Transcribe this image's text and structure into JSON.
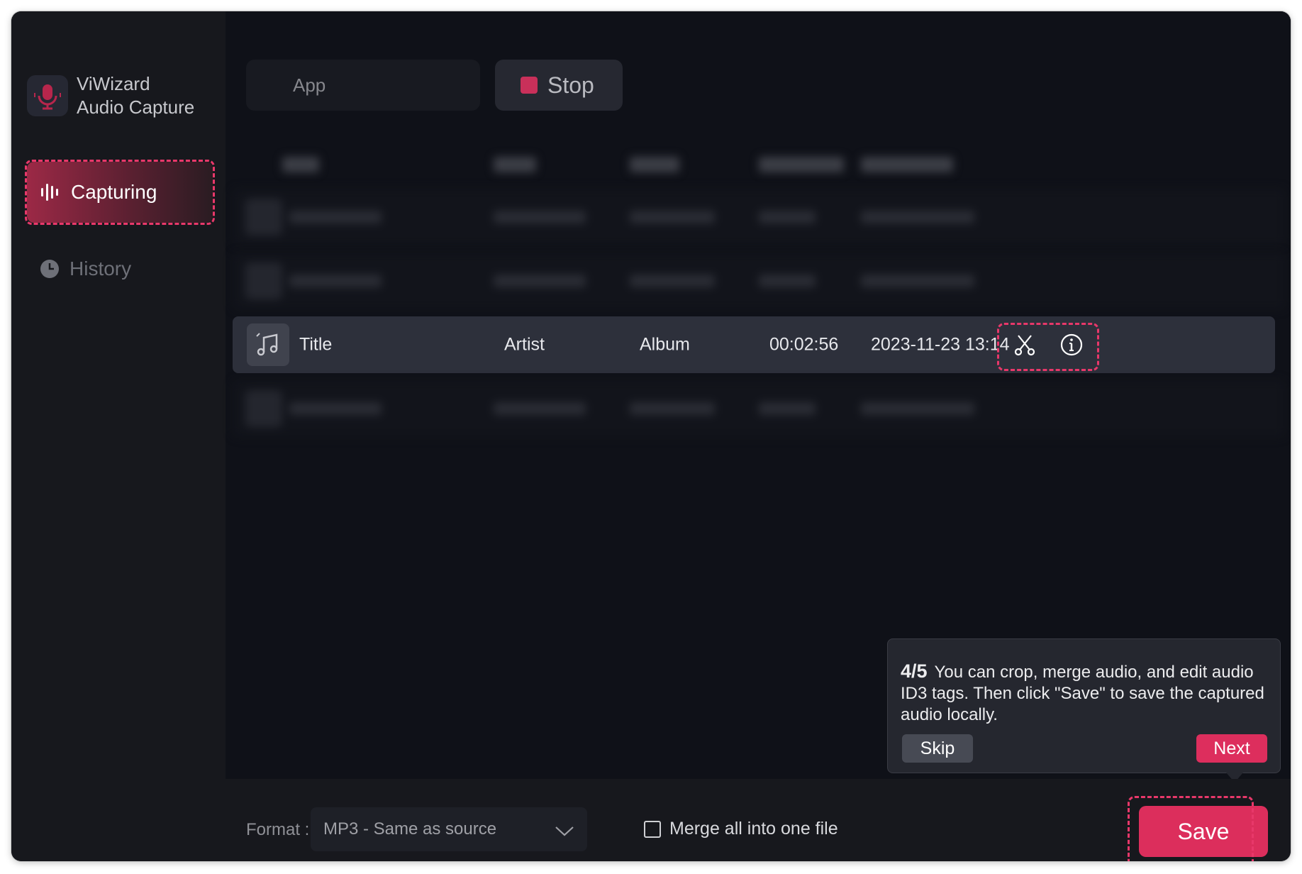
{
  "app": {
    "name_line1": "ViWizard",
    "name_line2": "Audio Capture"
  },
  "sidebar": {
    "items": [
      {
        "label": "Capturing",
        "icon": "waveform-icon",
        "active": true
      },
      {
        "label": "History",
        "icon": "clock-icon",
        "active": false
      }
    ]
  },
  "toolbar": {
    "app_placeholder": "App",
    "stop_label": "Stop"
  },
  "track": {
    "title": "Title",
    "artist": "Artist",
    "album": "Album",
    "duration": "00:02:56",
    "date_added": "2023-11-23 13:14"
  },
  "tooltip": {
    "step": "4/5",
    "text": "You can crop, merge audio, and edit audio ID3 tags. Then click \"Save\" to save the captured audio locally.",
    "skip_label": "Skip",
    "next_label": "Next"
  },
  "footer": {
    "format_label": "Format :",
    "format_value": "MP3 - Same as source",
    "merge_label": "Merge all into one file",
    "merge_checked": false,
    "save_label": "Save"
  },
  "colors": {
    "accent": "#dc2e5c",
    "highlight_dash": "#e8386a",
    "window_bg": "#10121a",
    "sidebar_bg": "#17181d"
  }
}
